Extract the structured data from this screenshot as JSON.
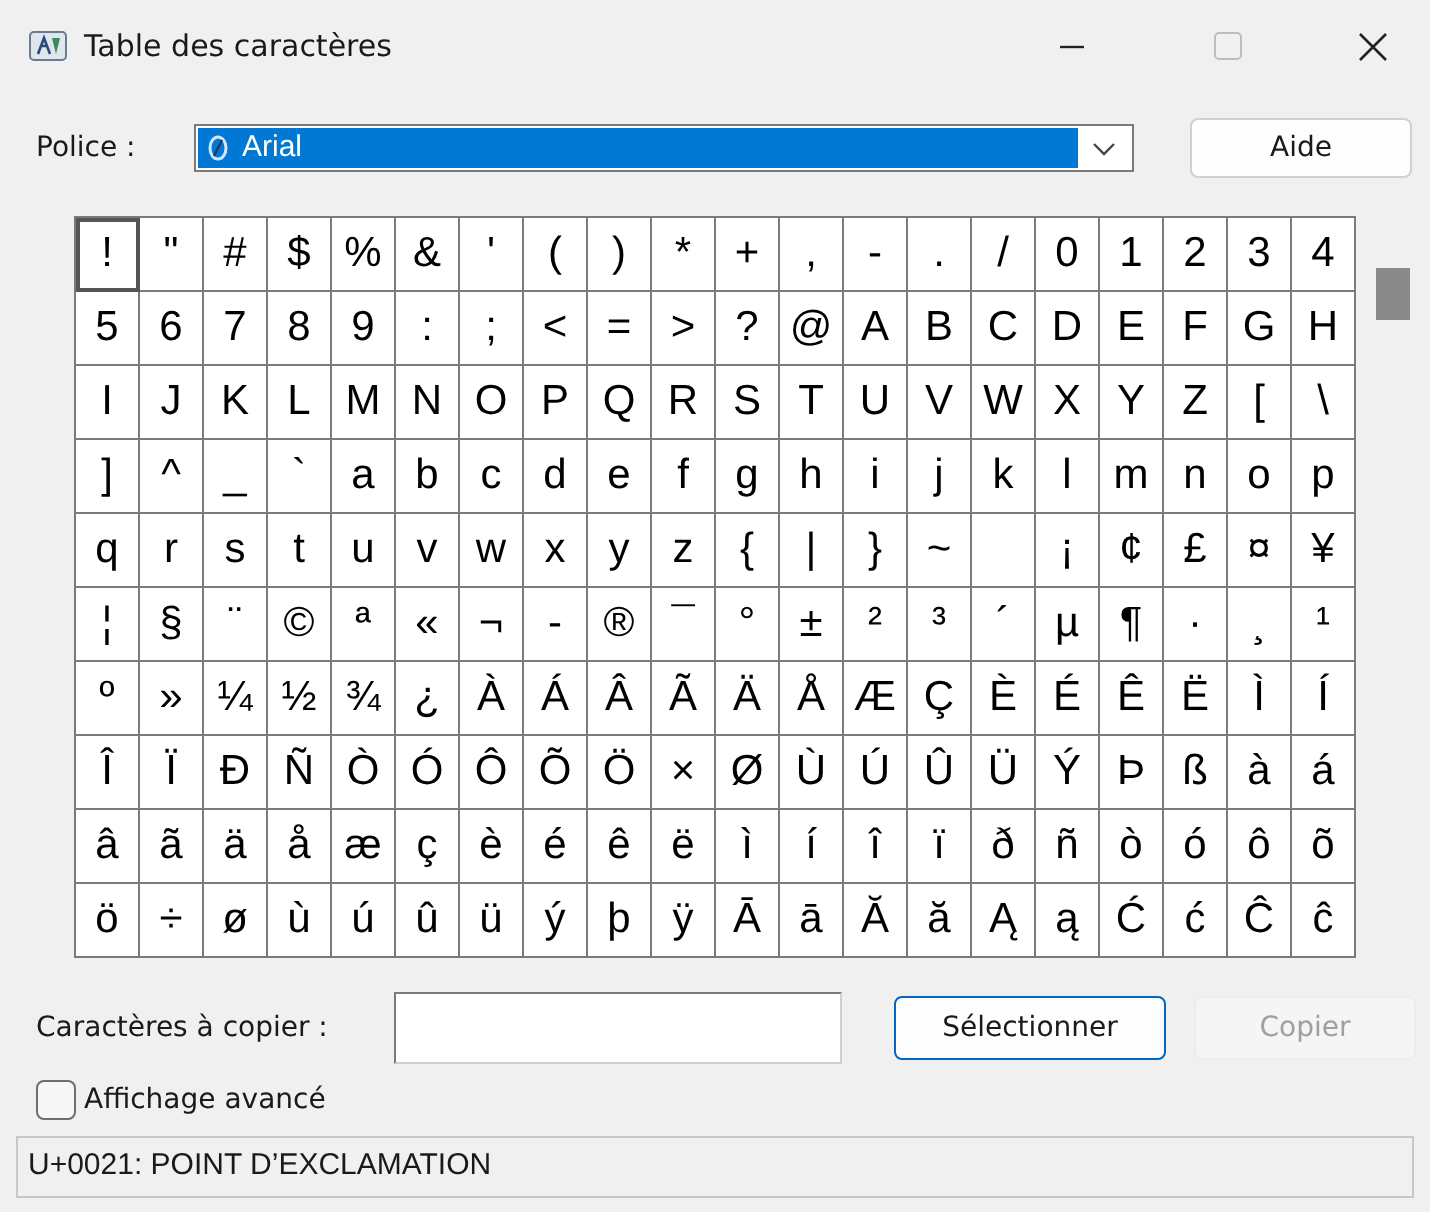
{
  "window": {
    "title": "Table des caractères"
  },
  "font_row": {
    "label": "Police :",
    "value": "Arial",
    "focused": true
  },
  "help_button": {
    "label": "Aide"
  },
  "grid": {
    "rows": [
      {
        "cells": [
          {
            "char": "!",
            "selected": true
          },
          {
            "char": "\"",
            "selected": false
          },
          {
            "char": "#",
            "selected": false
          },
          {
            "char": "$",
            "selected": false
          },
          {
            "char": "%",
            "selected": false
          },
          {
            "char": "&",
            "selected": false
          },
          {
            "char": "'",
            "selected": false
          },
          {
            "char": "(",
            "selected": false
          },
          {
            "char": ")",
            "selected": false
          },
          {
            "char": "*",
            "selected": false
          },
          {
            "char": "+",
            "selected": false
          },
          {
            "char": ",",
            "selected": false
          },
          {
            "char": "-",
            "selected": false
          },
          {
            "char": ".",
            "selected": false
          },
          {
            "char": "/",
            "selected": false
          },
          {
            "char": "0",
            "selected": false
          },
          {
            "char": "1",
            "selected": false
          },
          {
            "char": "2",
            "selected": false
          },
          {
            "char": "3",
            "selected": false
          },
          {
            "char": "4",
            "selected": false
          }
        ]
      },
      {
        "cells": [
          {
            "char": "5",
            "selected": false
          },
          {
            "char": "6",
            "selected": false
          },
          {
            "char": "7",
            "selected": false
          },
          {
            "char": "8",
            "selected": false
          },
          {
            "char": "9",
            "selected": false
          },
          {
            "char": ":",
            "selected": false
          },
          {
            "char": ";",
            "selected": false
          },
          {
            "char": "<",
            "selected": false
          },
          {
            "char": "=",
            "selected": false
          },
          {
            "char": ">",
            "selected": false
          },
          {
            "char": "?",
            "selected": false
          },
          {
            "char": "@",
            "selected": false
          },
          {
            "char": "A",
            "selected": false
          },
          {
            "char": "B",
            "selected": false
          },
          {
            "char": "C",
            "selected": false
          },
          {
            "char": "D",
            "selected": false
          },
          {
            "char": "E",
            "selected": false
          },
          {
            "char": "F",
            "selected": false
          },
          {
            "char": "G",
            "selected": false
          },
          {
            "char": "H",
            "selected": false
          }
        ]
      },
      {
        "cells": [
          {
            "char": "I",
            "selected": false
          },
          {
            "char": "J",
            "selected": false
          },
          {
            "char": "K",
            "selected": false
          },
          {
            "char": "L",
            "selected": false
          },
          {
            "char": "M",
            "selected": false
          },
          {
            "char": "N",
            "selected": false
          },
          {
            "char": "O",
            "selected": false
          },
          {
            "char": "P",
            "selected": false
          },
          {
            "char": "Q",
            "selected": false
          },
          {
            "char": "R",
            "selected": false
          },
          {
            "char": "S",
            "selected": false
          },
          {
            "char": "T",
            "selected": false
          },
          {
            "char": "U",
            "selected": false
          },
          {
            "char": "V",
            "selected": false
          },
          {
            "char": "W",
            "selected": false
          },
          {
            "char": "X",
            "selected": false
          },
          {
            "char": "Y",
            "selected": false
          },
          {
            "char": "Z",
            "selected": false
          },
          {
            "char": "[",
            "selected": false
          },
          {
            "char": "\\",
            "selected": false
          }
        ]
      },
      {
        "cells": [
          {
            "char": "]",
            "selected": false
          },
          {
            "char": "^",
            "selected": false
          },
          {
            "char": "_",
            "selected": false
          },
          {
            "char": "`",
            "selected": false
          },
          {
            "char": "a",
            "selected": false
          },
          {
            "char": "b",
            "selected": false
          },
          {
            "char": "c",
            "selected": false
          },
          {
            "char": "d",
            "selected": false
          },
          {
            "char": "e",
            "selected": false
          },
          {
            "char": "f",
            "selected": false
          },
          {
            "char": "g",
            "selected": false
          },
          {
            "char": "h",
            "selected": false
          },
          {
            "char": "i",
            "selected": false
          },
          {
            "char": "j",
            "selected": false
          },
          {
            "char": "k",
            "selected": false
          },
          {
            "char": "l",
            "selected": false
          },
          {
            "char": "m",
            "selected": false
          },
          {
            "char": "n",
            "selected": false
          },
          {
            "char": "o",
            "selected": false
          },
          {
            "char": "p",
            "selected": false
          }
        ]
      },
      {
        "cells": [
          {
            "char": "q",
            "selected": false
          },
          {
            "char": "r",
            "selected": false
          },
          {
            "char": "s",
            "selected": false
          },
          {
            "char": "t",
            "selected": false
          },
          {
            "char": "u",
            "selected": false
          },
          {
            "char": "v",
            "selected": false
          },
          {
            "char": "w",
            "selected": false
          },
          {
            "char": "x",
            "selected": false
          },
          {
            "char": "y",
            "selected": false
          },
          {
            "char": "z",
            "selected": false
          },
          {
            "char": "{",
            "selected": false
          },
          {
            "char": "|",
            "selected": false
          },
          {
            "char": "}",
            "selected": false
          },
          {
            "char": "~",
            "selected": false
          },
          {
            "selected": false
          },
          {
            "char": "¡",
            "selected": false
          },
          {
            "char": "¢",
            "selected": false
          },
          {
            "char": "£",
            "selected": false
          },
          {
            "char": "¤",
            "selected": false
          },
          {
            "char": "¥",
            "selected": false
          }
        ]
      },
      {
        "cells": [
          {
            "char": "¦",
            "selected": false
          },
          {
            "char": "§",
            "selected": false
          },
          {
            "char": "¨",
            "selected": false
          },
          {
            "char": "©",
            "selected": false
          },
          {
            "char": "ª",
            "selected": false
          },
          {
            "char": "«",
            "selected": false
          },
          {
            "char": "¬",
            "selected": false
          },
          {
            "char": "-",
            "selected": false
          },
          {
            "char": "®",
            "selected": false
          },
          {
            "char": "¯",
            "selected": false
          },
          {
            "char": "°",
            "selected": false
          },
          {
            "char": "±",
            "selected": false
          },
          {
            "char": "²",
            "selected": false
          },
          {
            "char": "³",
            "selected": false
          },
          {
            "char": "´",
            "selected": false
          },
          {
            "char": "µ",
            "selected": false
          },
          {
            "char": "¶",
            "selected": false
          },
          {
            "char": "·",
            "selected": false
          },
          {
            "char": "¸",
            "selected": false
          },
          {
            "char": "¹",
            "selected": false
          }
        ]
      },
      {
        "cells": [
          {
            "char": "º",
            "selected": false
          },
          {
            "char": "»",
            "selected": false
          },
          {
            "char": "¼",
            "selected": false
          },
          {
            "char": "½",
            "selected": false
          },
          {
            "char": "¾",
            "selected": false
          },
          {
            "char": "¿",
            "selected": false
          },
          {
            "char": "À",
            "selected": false
          },
          {
            "char": "Á",
            "selected": false
          },
          {
            "char": "Â",
            "selected": false
          },
          {
            "char": "Ã",
            "selected": false
          },
          {
            "char": "Ä",
            "selected": false
          },
          {
            "char": "Å",
            "selected": false
          },
          {
            "char": "Æ",
            "selected": false
          },
          {
            "char": "Ç",
            "selected": false
          },
          {
            "char": "È",
            "selected": false
          },
          {
            "char": "É",
            "selected": false
          },
          {
            "char": "Ê",
            "selected": false
          },
          {
            "char": "Ë",
            "selected": false
          },
          {
            "char": "Ì",
            "selected": false
          },
          {
            "char": "Í",
            "selected": false
          }
        ]
      },
      {
        "cells": [
          {
            "char": "Î",
            "selected": false
          },
          {
            "char": "Ï",
            "selected": false
          },
          {
            "char": "Ð",
            "selected": false
          },
          {
            "char": "Ñ",
            "selected": false
          },
          {
            "char": "Ò",
            "selected": false
          },
          {
            "char": "Ó",
            "selected": false
          },
          {
            "char": "Ô",
            "selected": false
          },
          {
            "char": "Õ",
            "selected": false
          },
          {
            "char": "Ö",
            "selected": false
          },
          {
            "char": "×",
            "selected": false
          },
          {
            "char": "Ø",
            "selected": false
          },
          {
            "char": "Ù",
            "selected": false
          },
          {
            "char": "Ú",
            "selected": false
          },
          {
            "char": "Û",
            "selected": false
          },
          {
            "char": "Ü",
            "selected": false
          },
          {
            "char": "Ý",
            "selected": false
          },
          {
            "char": "Þ",
            "selected": false
          },
          {
            "char": "ß",
            "selected": false
          },
          {
            "char": "à",
            "selected": false
          },
          {
            "char": "á",
            "selected": false
          }
        ]
      },
      {
        "cells": [
          {
            "char": "â",
            "selected": false
          },
          {
            "char": "ã",
            "selected": false
          },
          {
            "char": "ä",
            "selected": false
          },
          {
            "char": "å",
            "selected": false
          },
          {
            "char": "æ",
            "selected": false
          },
          {
            "char": "ç",
            "selected": false
          },
          {
            "char": "è",
            "selected": false
          },
          {
            "char": "é",
            "selected": false
          },
          {
            "char": "ê",
            "selected": false
          },
          {
            "char": "ë",
            "selected": false
          },
          {
            "char": "ì",
            "selected": false
          },
          {
            "char": "í",
            "selected": false
          },
          {
            "char": "î",
            "selected": false
          },
          {
            "char": "ï",
            "selected": false
          },
          {
            "char": "ð",
            "selected": false
          },
          {
            "char": "ñ",
            "selected": false
          },
          {
            "char": "ò",
            "selected": false
          },
          {
            "char": "ó",
            "selected": false
          },
          {
            "char": "ô",
            "selected": false
          },
          {
            "char": "õ",
            "selected": false
          }
        ]
      },
      {
        "cells": [
          {
            "char": "ö",
            "selected": false
          },
          {
            "char": "÷",
            "selected": false
          },
          {
            "char": "ø",
            "selected": false
          },
          {
            "char": "ù",
            "selected": false
          },
          {
            "char": "ú",
            "selected": false
          },
          {
            "char": "û",
            "selected": false
          },
          {
            "char": "ü",
            "selected": false
          },
          {
            "char": "ý",
            "selected": false
          },
          {
            "char": "þ",
            "selected": false
          },
          {
            "char": "ÿ",
            "selected": false
          },
          {
            "char": "Ā",
            "selected": false
          },
          {
            "char": "ā",
            "selected": false
          },
          {
            "char": "Ă",
            "selected": false
          },
          {
            "char": "ă",
            "selected": false
          },
          {
            "char": "Ą",
            "selected": false
          },
          {
            "char": "ą",
            "selected": false
          },
          {
            "char": "Ć",
            "selected": false
          },
          {
            "char": "ć",
            "selected": false
          },
          {
            "char": "Ĉ",
            "selected": false
          },
          {
            "char": "ĉ",
            "selected": false
          }
        ]
      }
    ]
  },
  "copy_row": {
    "label": "Caractères à copier :"
  },
  "select_button": {
    "label": "Sélectionner"
  },
  "copy_button": {
    "label": "Copier",
    "disabled": true
  },
  "advanced_view": {
    "label": "Affichage avancé",
    "checked": false
  },
  "status_bar": {
    "text": "U+0021: POINT D’EXCLAMATION"
  }
}
